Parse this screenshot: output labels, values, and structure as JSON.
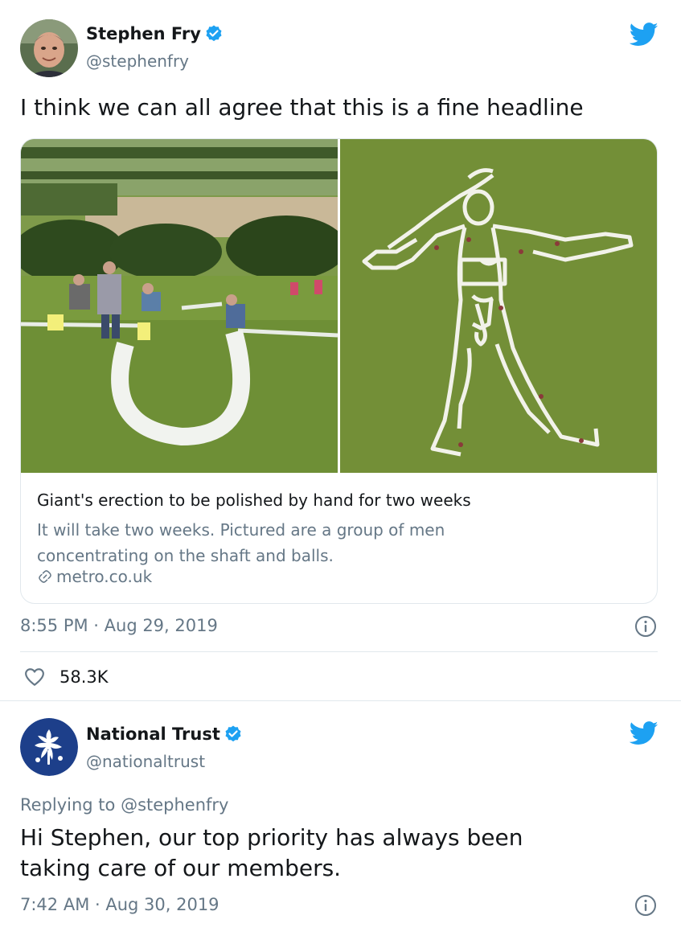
{
  "tweets": [
    {
      "display_name": "Stephen Fry",
      "handle": "@stephenfry",
      "text": "I think we can all agree that this is a fine headline",
      "card": {
        "title": "Giant's erection to be polished by hand for two weeks",
        "description": "It will take two weeks. Pictured are a group of men concentrating on the shaft and balls.",
        "link": "metro.co.uk"
      },
      "timestamp": "8:55 PM · Aug 29, 2019",
      "likes": "58.3K"
    },
    {
      "display_name": "National Trust",
      "handle": "@nationaltrust",
      "replying_to": "Replying to @stephenfry",
      "text_line1": "Hi Stephen, our top priority has always been",
      "text_line2": "taking care of our members.",
      "timestamp": "7:42 AM · Aug 30, 2019"
    }
  ],
  "colors": {
    "twitter_blue": "#1da1f2",
    "national_trust_navy": "#1d3f8a",
    "secondary_text": "#657786",
    "grass": "#6f8f3a"
  },
  "icons": [
    "verified-icon",
    "twitter-bird-icon",
    "link-icon",
    "info-icon",
    "heart-icon"
  ]
}
